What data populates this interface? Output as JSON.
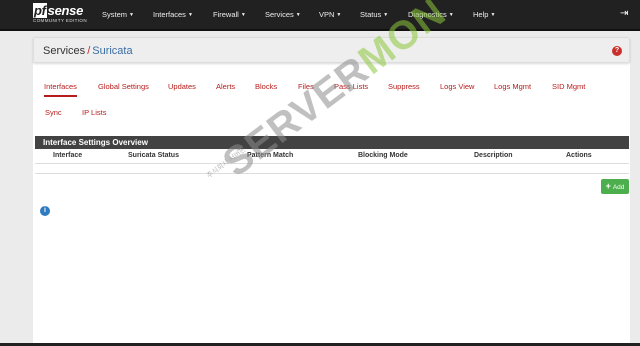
{
  "nav": {
    "logo_brand": "sense",
    "logo_pf": "pf",
    "logo_edition": "COMMUNITY EDITION",
    "menus": [
      "System",
      "Interfaces",
      "Firewall",
      "Services",
      "VPN",
      "Status",
      "Diagnostics",
      "Help"
    ],
    "logout_icon": "logout-icon"
  },
  "breadcrumb": {
    "section": "Services",
    "separator": "/",
    "page": "Suricata",
    "help_icon": "?"
  },
  "tabs": [
    "Interfaces",
    "Global Settings",
    "Updates",
    "Alerts",
    "Blocks",
    "Files",
    "Pass Lists",
    "Suppress",
    "Logs View",
    "Logs Mgmt",
    "SID Mgmt",
    "Sync",
    "IP Lists"
  ],
  "active_tab": "Interfaces",
  "panel": {
    "title": "Interface Settings Overview",
    "columns": [
      "Interface",
      "Suricata Status",
      "Pattern Match",
      "Blocking Mode",
      "Description",
      "Actions"
    ]
  },
  "add_button": {
    "icon": "+",
    "label": "Add"
  },
  "info_icon": "i",
  "watermark": {
    "part1": "SERVER",
    "part2": "MON",
    "small": "주식회사 서버몬"
  },
  "colors": {
    "topbar": "#212121",
    "tab_link": "#b71c1c",
    "panel_head": "#424242",
    "add_button": "#4cae4c",
    "info": "#2f7bc2"
  }
}
